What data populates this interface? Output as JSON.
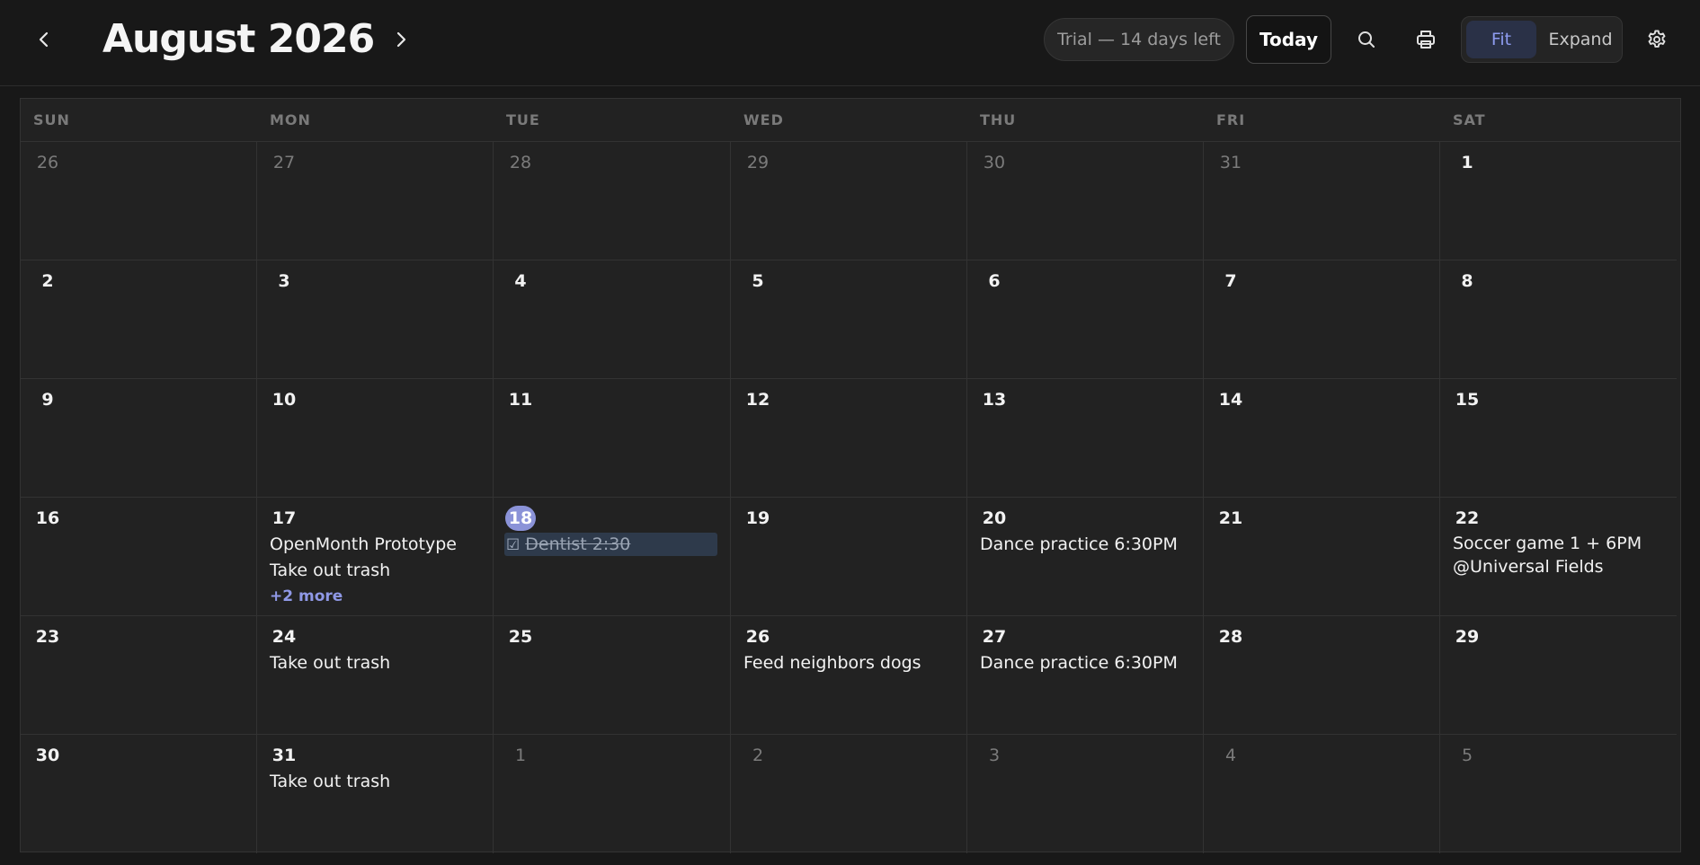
{
  "header": {
    "month_title": "August 2026",
    "trial_label": "Trial — 14 days left",
    "today_label": "Today",
    "view_fit_label": "Fit",
    "view_expand_label": "Expand",
    "icons": {
      "prev": "chevron-left-icon",
      "next": "chevron-right-icon",
      "search": "search-icon",
      "print": "printer-icon",
      "settings": "gear-icon"
    }
  },
  "colors": {
    "background": "#181818",
    "grid": "#222222",
    "accent": "#8b93d8",
    "more_link": "#8f98e6",
    "task_bg": "#2e3a4b"
  },
  "calendar": {
    "weekdays": [
      "SUN",
      "MON",
      "TUE",
      "WED",
      "THU",
      "FRI",
      "SAT"
    ],
    "weeks": [
      [
        {
          "day": "26",
          "muted": true,
          "events": []
        },
        {
          "day": "27",
          "muted": true,
          "events": []
        },
        {
          "day": "28",
          "muted": true,
          "events": []
        },
        {
          "day": "29",
          "muted": true,
          "events": []
        },
        {
          "day": "30",
          "muted": true,
          "events": []
        },
        {
          "day": "31",
          "muted": true,
          "events": []
        },
        {
          "day": "1",
          "events": []
        }
      ],
      [
        {
          "day": "2",
          "events": []
        },
        {
          "day": "3",
          "events": []
        },
        {
          "day": "4",
          "events": []
        },
        {
          "day": "5",
          "events": []
        },
        {
          "day": "6",
          "events": []
        },
        {
          "day": "7",
          "events": []
        },
        {
          "day": "8",
          "events": []
        }
      ],
      [
        {
          "day": "9",
          "events": []
        },
        {
          "day": "10",
          "events": []
        },
        {
          "day": "11",
          "events": []
        },
        {
          "day": "12",
          "events": []
        },
        {
          "day": "13",
          "events": []
        },
        {
          "day": "14",
          "events": []
        },
        {
          "day": "15",
          "events": []
        }
      ],
      [
        {
          "day": "16",
          "events": []
        },
        {
          "day": "17",
          "events": [
            "OpenMonth Prototype",
            "Take out trash"
          ],
          "more": "+2 more"
        },
        {
          "day": "18",
          "today": true,
          "events": [],
          "tasks": [
            {
              "checkbox": "☑",
              "text": "Dentist 2:30",
              "done": true
            }
          ]
        },
        {
          "day": "19",
          "events": []
        },
        {
          "day": "20",
          "events": [
            "Dance practice 6:30PM"
          ]
        },
        {
          "day": "21",
          "events": []
        },
        {
          "day": "22",
          "events": [
            "Soccer game 1 + 6PM @Universal Fields"
          ],
          "wrap": true
        }
      ],
      [
        {
          "day": "23",
          "events": []
        },
        {
          "day": "24",
          "events": [
            "Take out trash"
          ]
        },
        {
          "day": "25",
          "events": []
        },
        {
          "day": "26",
          "events": [
            "Feed neighbors dogs"
          ]
        },
        {
          "day": "27",
          "events": [
            "Dance practice 6:30PM"
          ]
        },
        {
          "day": "28",
          "events": []
        },
        {
          "day": "29",
          "events": []
        }
      ],
      [
        {
          "day": "30",
          "events": []
        },
        {
          "day": "31",
          "events": [
            "Take out trash"
          ]
        },
        {
          "day": "1",
          "muted": true,
          "events": []
        },
        {
          "day": "2",
          "muted": true,
          "events": []
        },
        {
          "day": "3",
          "muted": true,
          "events": []
        },
        {
          "day": "4",
          "muted": true,
          "events": []
        },
        {
          "day": "5",
          "muted": true,
          "events": []
        }
      ]
    ]
  }
}
